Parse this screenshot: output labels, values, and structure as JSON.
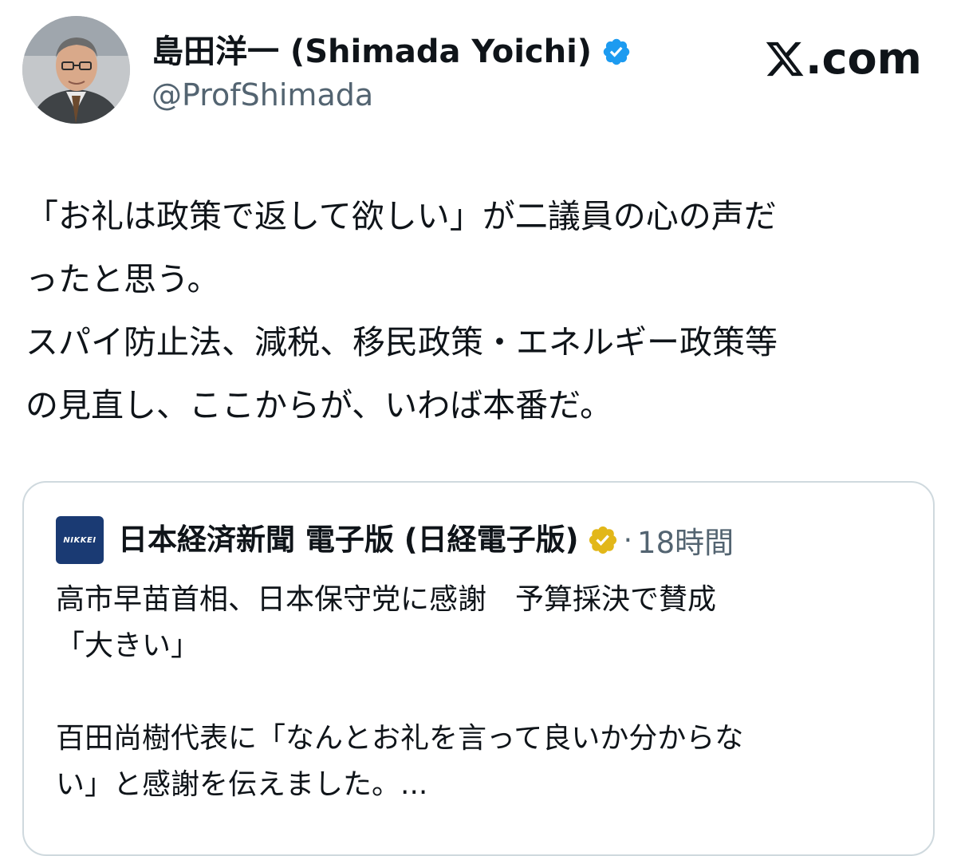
{
  "header": {
    "display_name": "島田洋一 (Shimada Yoichi)",
    "handle": "@ProfShimada",
    "brand": ".com",
    "avatar_icon": "profile-photo",
    "badge_color": "#1d9bf0"
  },
  "tweet": {
    "lines": [
      "「お礼は政策で返して欲しい」が二議員の心の声だ",
      "ったと思う。",
      "スパイ防止法、減税、移民政策・エネルギー政策等",
      "の見直し、ここからが、いわば本番だ。"
    ]
  },
  "quote": {
    "logo_text": "NIKKEI",
    "author": "日本経済新聞 電子版 (日経電子版)",
    "separator": "·",
    "time": "18時間",
    "badge_color": "#e2b719",
    "body_lines": [
      "高市早苗首相、日本保守党に感謝　予算採決で賛成",
      "「大きい」",
      "",
      "百田尚樹代表に「なんとお礼を言って良いか分からな",
      "い」と感謝を伝えました。..."
    ]
  }
}
